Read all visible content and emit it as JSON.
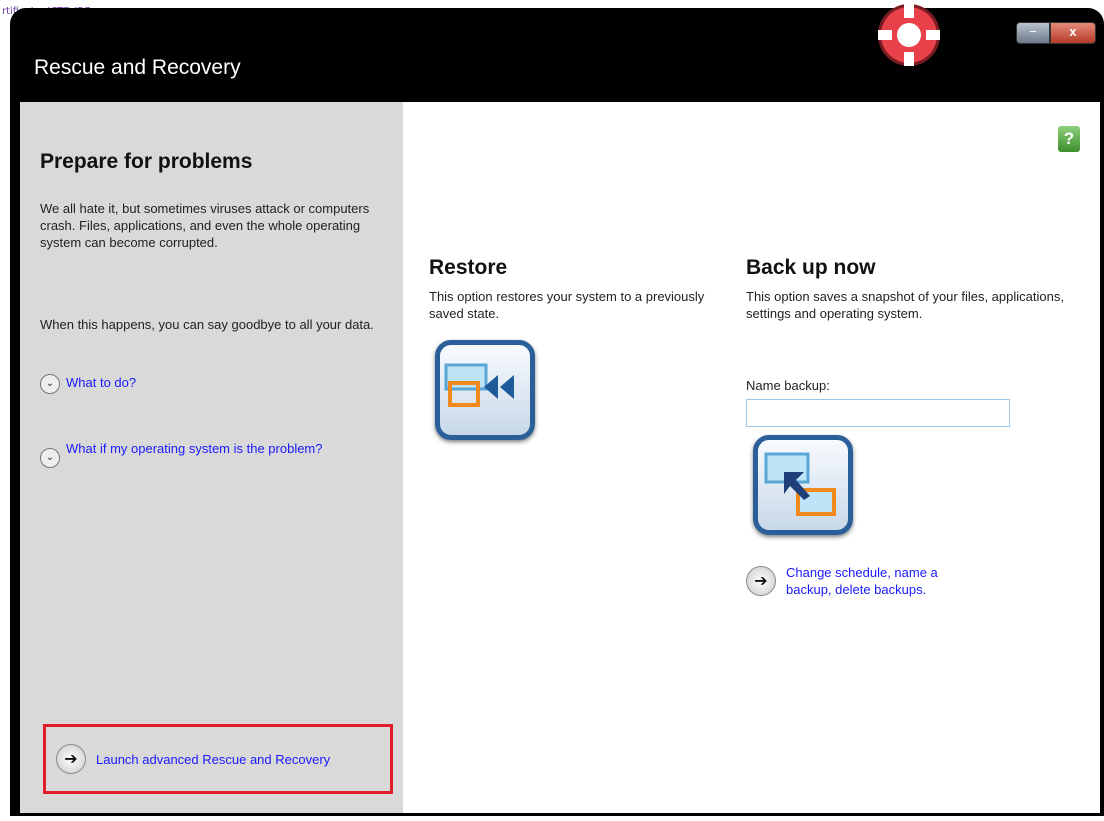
{
  "desktop": {
    "partial_text": "rtificat... ICTD.JPG"
  },
  "window": {
    "title": "Rescue and Recovery",
    "minimize": "−",
    "close": "x"
  },
  "sidebar": {
    "title": "Prepare for problems",
    "para1": "We all hate it, but sometimes viruses attack or computers crash. Files, applications, and even the whole operating system can become corrupted.",
    "para2": "When this happens, you can say goodbye to all your data.",
    "link1": "What to do?",
    "link2": "What if my operating system is the problem?",
    "launch": "Launch advanced Rescue and Recovery"
  },
  "restore": {
    "title": "Restore",
    "desc": "This option restores your system to a previously saved state."
  },
  "backup": {
    "title": "Back up now",
    "desc": "This option saves a snapshot of your files, applications, settings and operating system.",
    "name_label": "Name backup:",
    "name_value": "",
    "change_link": "Change schedule, name a backup, delete backups."
  },
  "colors": {
    "accent": "#2b5f9a",
    "highlight": "#e21d2a",
    "link": "#1a1aff"
  }
}
